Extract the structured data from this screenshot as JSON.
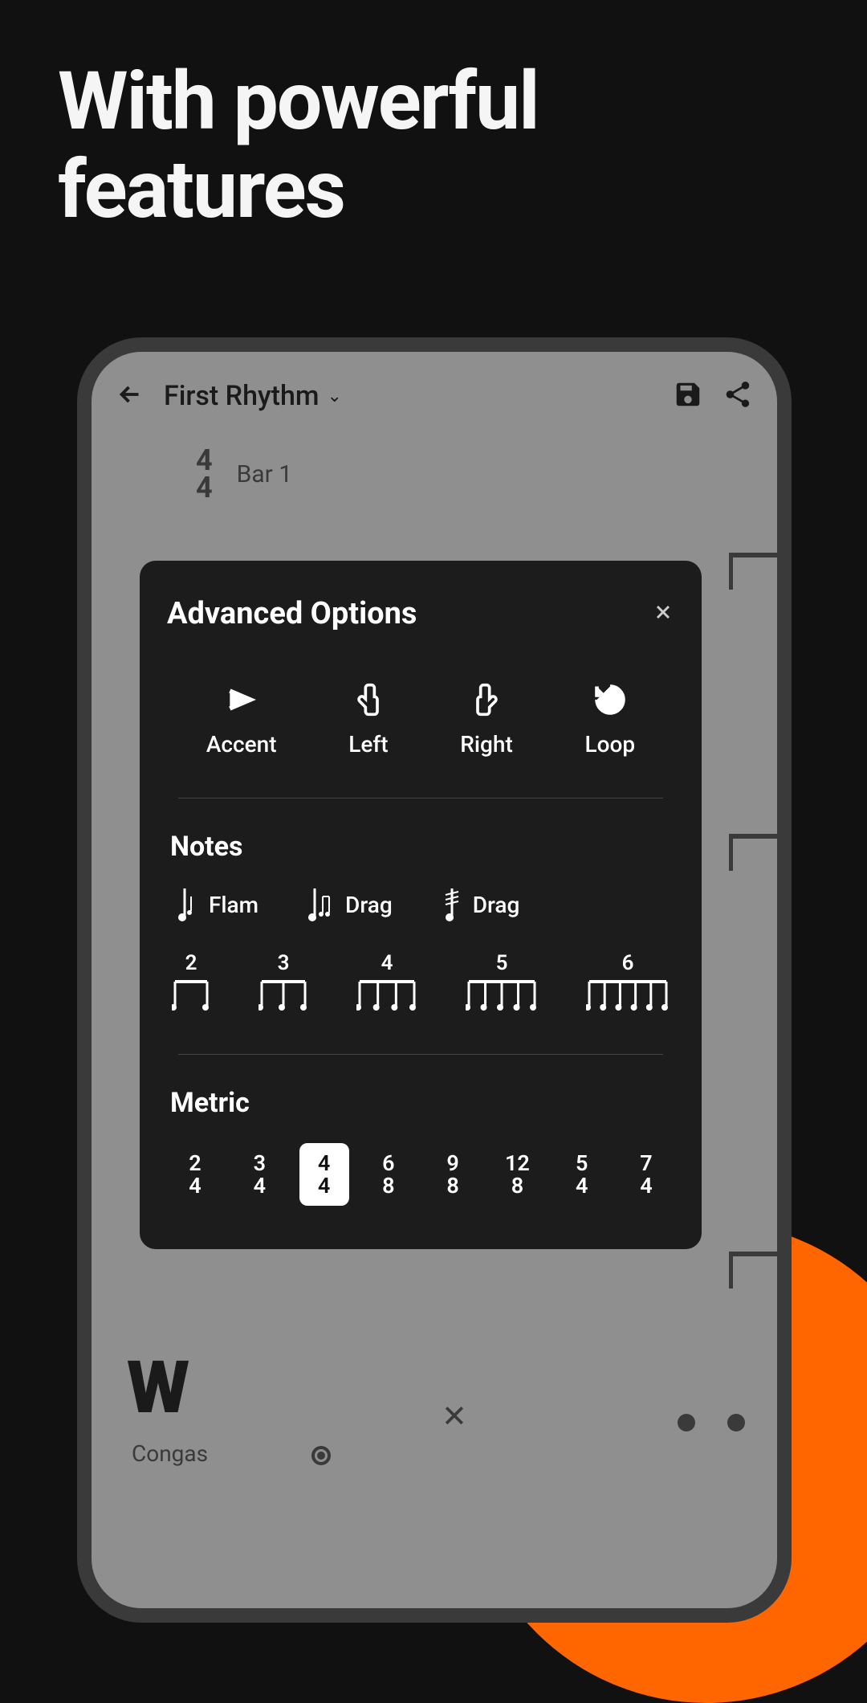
{
  "headline": "With powerful features",
  "app": {
    "title": "First Rhythm",
    "time_sig_top": "4",
    "time_sig_bottom": "4",
    "bar_label": "Bar 1",
    "instrument": "Congas"
  },
  "modal": {
    "title": "Advanced Options",
    "tools": {
      "accent": "Accent",
      "left": "Left",
      "right": "Right",
      "loop": "Loop"
    },
    "notes_section": "Notes",
    "note_options": {
      "flam": "Flam",
      "drag1": "Drag",
      "drag2": "Drag"
    },
    "groupings": [
      "2",
      "3",
      "4",
      "5",
      "6"
    ],
    "metric_section": "Metric",
    "metrics": [
      {
        "top": "2",
        "bottom": "4",
        "selected": false
      },
      {
        "top": "3",
        "bottom": "4",
        "selected": false
      },
      {
        "top": "4",
        "bottom": "4",
        "selected": true
      },
      {
        "top": "6",
        "bottom": "8",
        "selected": false
      },
      {
        "top": "9",
        "bottom": "8",
        "selected": false
      },
      {
        "top": "12",
        "bottom": "8",
        "selected": false
      },
      {
        "top": "5",
        "bottom": "4",
        "selected": false
      },
      {
        "top": "7",
        "bottom": "4",
        "selected": false
      }
    ]
  }
}
